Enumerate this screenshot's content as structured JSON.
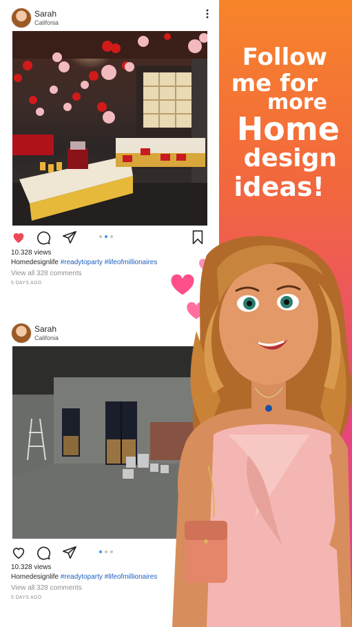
{
  "promo": {
    "line1": "Follow",
    "line2": "me for",
    "line3": "more",
    "line4": "Home",
    "line5": "design",
    "line6": "ideas!"
  },
  "posts": [
    {
      "user": "Sarah",
      "location": "Califonia",
      "views": "10.328 views",
      "account": "Homedesignlife",
      "tags": "#readytoparty #lifeofmillionaires",
      "comments": "View all 328 comments",
      "ago": "5 DAYS AGO",
      "liked": true
    },
    {
      "user": "Sarah",
      "location": "Califonia",
      "views": "10.328 views",
      "account": "Homedesignlife",
      "tags": "#readytoparty #lifeofmillionaires",
      "comments": "View all 328 comments",
      "ago": "5 DAYS AGO",
      "liked": false
    }
  ],
  "colors": {
    "gradient_top": "#f7842a",
    "gradient_bottom": "#e23f8b",
    "like_red": "#ed4956",
    "hashtag_blue": "#1d5fbf",
    "float_heart_pink": "#ff4f8b"
  },
  "icons": [
    "heart-icon",
    "comment-icon",
    "send-icon",
    "bookmark-icon",
    "more-icon"
  ]
}
